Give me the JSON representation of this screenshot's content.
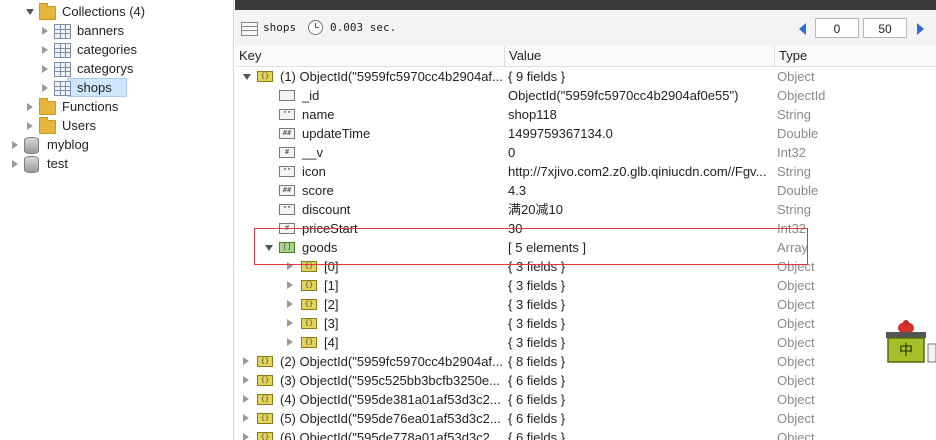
{
  "tree": [
    {
      "label": "Collections (4)",
      "icon": "folder-icon",
      "expanded": true,
      "depth": 1
    },
    {
      "label": "banners",
      "icon": "collection-icon",
      "expanded": false,
      "depth": 2
    },
    {
      "label": "categories",
      "icon": "collection-icon",
      "expanded": false,
      "depth": 2
    },
    {
      "label": "categorys",
      "icon": "collection-icon",
      "expanded": false,
      "depth": 2
    },
    {
      "label": "shops",
      "icon": "collection-icon",
      "expanded": false,
      "depth": 2,
      "selected": true
    },
    {
      "label": "Functions",
      "icon": "folder-icon",
      "expanded": false,
      "depth": 1
    },
    {
      "label": "Users",
      "icon": "folder-icon",
      "expanded": false,
      "depth": 1
    },
    {
      "label": "myblog",
      "icon": "database-icon",
      "expanded": false,
      "depth": 0
    },
    {
      "label": "test",
      "icon": "database-icon",
      "expanded": false,
      "depth": 0
    }
  ],
  "toolbar": {
    "collection": "shops",
    "time": "0.003 sec.",
    "skip": "0",
    "limit": "50"
  },
  "grid": {
    "columns": [
      "Key",
      "Value",
      "Type"
    ],
    "rows": [
      {
        "indent": 0,
        "arrow": "open",
        "icon": "object-icon",
        "key": "(1) ObjectId(\"5959fc5970cc4b2904af...",
        "value": "{ 9 fields }",
        "type": "Object"
      },
      {
        "indent": 1,
        "arrow": "none",
        "icon": "id-icon",
        "key": "_id",
        "value": "ObjectId(\"5959fc5970cc4b2904af0e55\")",
        "type": "ObjectId"
      },
      {
        "indent": 1,
        "arrow": "none",
        "icon": "string-icon",
        "key": "name",
        "value": "shop118",
        "type": "String"
      },
      {
        "indent": 1,
        "arrow": "none",
        "icon": "number-icon",
        "key": "updateTime",
        "value": "1499759367134.0",
        "type": "Double"
      },
      {
        "indent": 1,
        "arrow": "none",
        "icon": "int-icon",
        "key": "__v",
        "value": "0",
        "type": "Int32"
      },
      {
        "indent": 1,
        "arrow": "none",
        "icon": "string-icon",
        "key": "icon",
        "value": "http://7xjivo.com2.z0.glb.qiniucdn.com//Fgv...",
        "type": "String"
      },
      {
        "indent": 1,
        "arrow": "none",
        "icon": "number-icon",
        "key": "score",
        "value": "4.3",
        "type": "Double"
      },
      {
        "indent": 1,
        "arrow": "none",
        "icon": "string-icon",
        "key": "discount",
        "value": "满20减10",
        "type": "String"
      },
      {
        "indent": 1,
        "arrow": "none",
        "icon": "int-icon",
        "key": "priceStart",
        "value": "30",
        "type": "Int32"
      },
      {
        "indent": 1,
        "arrow": "open",
        "icon": "array-icon",
        "key": "goods",
        "value": "[ 5 elements ]",
        "type": "Array"
      },
      {
        "indent": 2,
        "arrow": "closed",
        "icon": "object-icon",
        "key": "[0]",
        "value": "{ 3 fields }",
        "type": "Object"
      },
      {
        "indent": 2,
        "arrow": "closed",
        "icon": "object-icon",
        "key": "[1]",
        "value": "{ 3 fields }",
        "type": "Object"
      },
      {
        "indent": 2,
        "arrow": "closed",
        "icon": "object-icon",
        "key": "[2]",
        "value": "{ 3 fields }",
        "type": "Object"
      },
      {
        "indent": 2,
        "arrow": "closed",
        "icon": "object-icon",
        "key": "[3]",
        "value": "{ 3 fields }",
        "type": "Object"
      },
      {
        "indent": 2,
        "arrow": "closed",
        "icon": "object-icon",
        "key": "[4]",
        "value": "{ 3 fields }",
        "type": "Object"
      },
      {
        "indent": 0,
        "arrow": "closed",
        "icon": "object-icon",
        "key": "(2) ObjectId(\"5959fc5970cc4b2904af...",
        "value": "{ 8 fields }",
        "type": "Object"
      },
      {
        "indent": 0,
        "arrow": "closed",
        "icon": "object-icon",
        "key": "(3) ObjectId(\"595c525bb3bcfb3250e...",
        "value": "{ 6 fields }",
        "type": "Object"
      },
      {
        "indent": 0,
        "arrow": "closed",
        "icon": "object-icon",
        "key": "(4) ObjectId(\"595de381a01af53d3c2...",
        "value": "{ 6 fields }",
        "type": "Object"
      },
      {
        "indent": 0,
        "arrow": "closed",
        "icon": "object-icon",
        "key": "(5) ObjectId(\"595de76ea01af53d3c2...",
        "value": "{ 6 fields }",
        "type": "Object"
      },
      {
        "indent": 0,
        "arrow": "closed",
        "icon": "object-icon",
        "key": "(6) ObjectId(\"595de778a01af53d3c2...",
        "value": "{ 6 fields }",
        "type": "Object"
      }
    ]
  },
  "ime_badge": "中",
  "colors": {
    "accent": "#2f6fd0",
    "highlight": "#e0383c",
    "selection": "#cde6fb"
  }
}
